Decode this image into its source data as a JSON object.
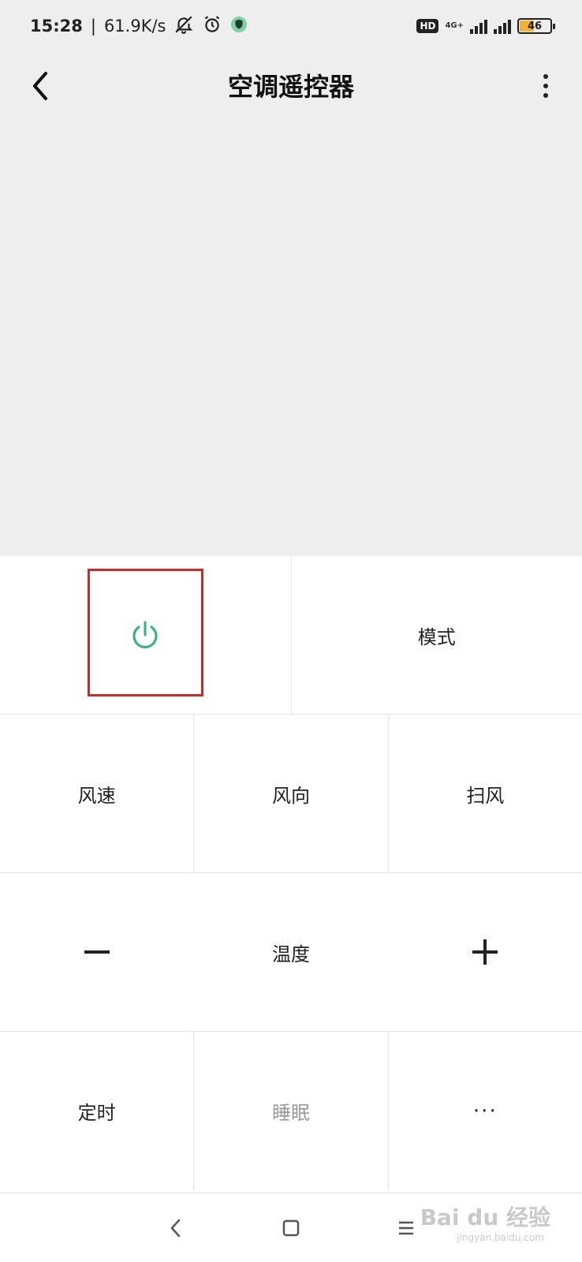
{
  "status_bar": {
    "time": "15:28",
    "separator": "|",
    "net_speed": "61.9K/s",
    "hd_label": "HD",
    "network_type": "4G+",
    "battery_level": "46"
  },
  "header": {
    "title": "空调遥控器"
  },
  "controls": {
    "mode_label": "模式",
    "fan_speed_label": "风速",
    "fan_direction_label": "风向",
    "swing_label": "扫风",
    "temperature_label": "温度",
    "timer_label": "定时",
    "sleep_label": "睡眠",
    "more_label": "···"
  },
  "colors": {
    "power_green": "#2bb673",
    "highlight_red": "#d32626",
    "background_top": "#eeeeee"
  },
  "watermark": {
    "text": "Bai du 经验",
    "sub": "jingyan.baidu.com"
  }
}
